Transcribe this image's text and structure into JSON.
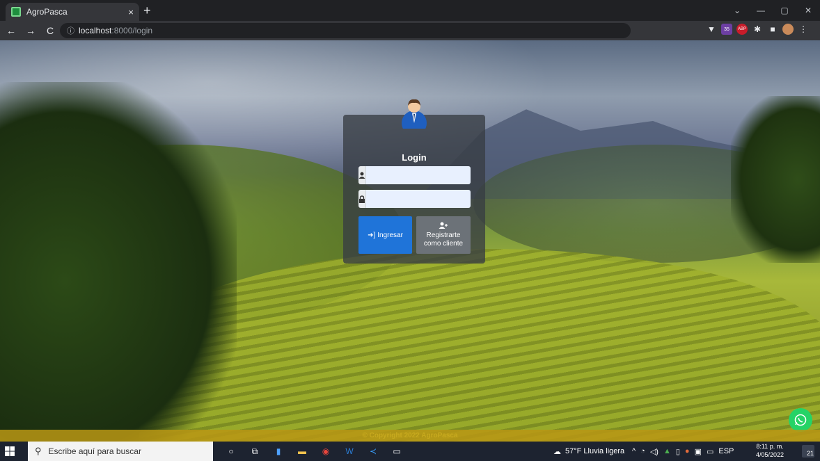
{
  "browser": {
    "tab_title": "AgroPasca",
    "tab_close": "×",
    "new_tab": "+",
    "url_host": "localhost",
    "url_path": ":8000/login",
    "window_controls": [
      "⌄",
      "—",
      "▢",
      "✕"
    ],
    "nav_icons": [
      "back-icon",
      "forward-icon",
      "reload-icon",
      "info-icon"
    ],
    "badge_count": "35",
    "badge_abp": "ABP"
  },
  "login": {
    "title": "Login",
    "username_value": "",
    "password_value": "",
    "login_button": "Ingresar",
    "register_line1": "Registrarte",
    "register_line2": "como cliente"
  },
  "footer": {
    "copyright": "© Copyright 2022 AgroPasca"
  },
  "taskbar": {
    "search_placeholder": "Escribe aquí para buscar",
    "weather": "57°F  Lluvia ligera",
    "language": "ESP",
    "time": "8:11 p. m.",
    "date": "4/05/2022",
    "notifications": "21"
  },
  "colors": {
    "primary_button": "#1f74d9",
    "secondary_button": "#6c7278",
    "whatsapp": "#25d366"
  }
}
